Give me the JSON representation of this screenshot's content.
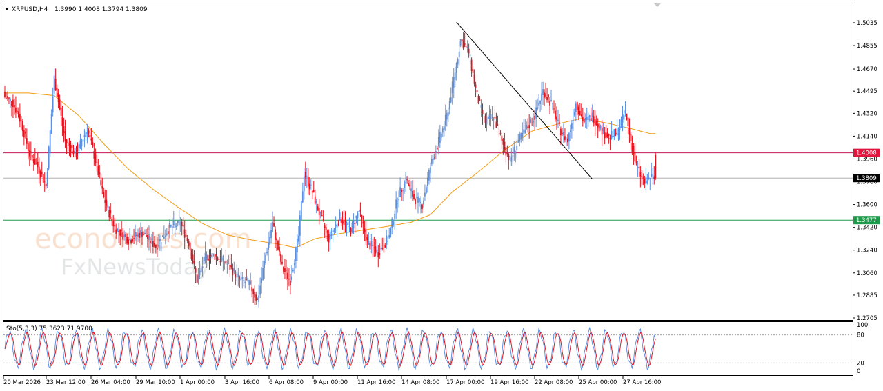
{
  "header": {
    "symbol_label": "XRPUSD,H4",
    "ohlc": "1.3990 1.4008 1.3794 1.3809"
  },
  "indicator": {
    "label": "Sto(5,3,3) 75.3623 71.9700",
    "levels": [
      "100",
      "80",
      "20",
      "0"
    ]
  },
  "watermark": {
    "line1": "economies.com",
    "line2": "FxNewsToday"
  },
  "price_axis": {
    "ticks": [
      "1.5035",
      "1.4855",
      "1.4670",
      "1.4495",
      "1.4320",
      "1.4140",
      "1.3960",
      "1.3780",
      "1.3600",
      "1.3420",
      "1.3240",
      "1.3060",
      "1.2885",
      "1.2705"
    ],
    "tick_values": [
      1.5035,
      1.4855,
      1.467,
      1.4495,
      1.432,
      1.414,
      1.396,
      1.378,
      1.36,
      1.342,
      1.324,
      1.306,
      1.2885,
      1.2705
    ],
    "badges": [
      {
        "label": "1.4008",
        "value": 1.4008,
        "color": "#e0143c",
        "text_color": "#ffffff"
      },
      {
        "label": "1.3809",
        "value": 1.3809,
        "color": "#000000",
        "text_color": "#ffffff"
      },
      {
        "label": "1.3477",
        "value": 1.3477,
        "color": "#1e9b4a",
        "text_color": "#ffffff"
      }
    ]
  },
  "time_axis": {
    "labels": [
      "20 Mar 2026",
      "23 Mar 12:00",
      "26 Mar 04:00",
      "29 Mar 10:00",
      "1 Apr 00:00",
      "3 Apr 16:00",
      "6 Apr 08:00",
      "9 Apr 00:00",
      "11 Apr 16:00",
      "14 Apr 08:00",
      "17 Apr 00:00",
      "19 Apr 16:00",
      "22 Apr 08:00",
      "25 Apr 00:00",
      "27 Apr 16:00"
    ]
  },
  "colors": {
    "bull": "#5b8fe0",
    "bear": "#e0141e",
    "ma": "#f39c12",
    "stoch_k": "#5b8fe0",
    "stoch_d": "#e0141e",
    "resistance": "#c2185b",
    "support": "#1e9b4a",
    "trendline": "#000000"
  },
  "chart_data": {
    "type": "candlestick",
    "symbol": "XRPUSD",
    "timeframe": "H4",
    "last_bar": {
      "open": 1.399,
      "high": 1.4008,
      "low": 1.3794,
      "close": 1.3809
    },
    "ylim": [
      1.2705,
      1.5035
    ],
    "horizontal_lines": [
      {
        "value": 1.4008
      },
      {
        "value": 1.3809
      },
      {
        "value": 1.3477
      }
    ],
    "trendline": [
      {
        "date": "17 Apr 00:00",
        "price": 1.504
      },
      {
        "date": "30 Apr 04:00",
        "price": 1.38
      }
    ],
    "close_waypoints": [
      [
        0,
        1.445
      ],
      [
        6,
        1.44
      ],
      [
        12,
        1.425
      ],
      [
        18,
        1.4
      ],
      [
        24,
        1.39
      ],
      [
        30,
        1.375
      ],
      [
        36,
        1.46
      ],
      [
        44,
        1.41
      ],
      [
        52,
        1.4
      ],
      [
        60,
        1.42
      ],
      [
        66,
        1.395
      ],
      [
        72,
        1.365
      ],
      [
        80,
        1.342
      ],
      [
        90,
        1.332
      ],
      [
        100,
        1.338
      ],
      [
        110,
        1.327
      ],
      [
        120,
        1.342
      ],
      [
        128,
        1.345
      ],
      [
        134,
        1.33
      ],
      [
        140,
        1.3
      ],
      [
        146,
        1.318
      ],
      [
        152,
        1.32
      ],
      [
        160,
        1.315
      ],
      [
        166,
        1.308
      ],
      [
        172,
        1.3
      ],
      [
        178,
        1.298
      ],
      [
        184,
        1.284
      ],
      [
        190,
        1.32
      ],
      [
        195,
        1.345
      ],
      [
        202,
        1.31
      ],
      [
        208,
        1.3
      ],
      [
        214,
        1.335
      ],
      [
        218,
        1.385
      ],
      [
        224,
        1.37
      ],
      [
        230,
        1.35
      ],
      [
        236,
        1.333
      ],
      [
        244,
        1.35
      ],
      [
        252,
        1.34
      ],
      [
        258,
        1.355
      ],
      [
        264,
        1.33
      ],
      [
        272,
        1.322
      ],
      [
        280,
        1.335
      ],
      [
        286,
        1.365
      ],
      [
        292,
        1.38
      ],
      [
        298,
        1.365
      ],
      [
        304,
        1.36
      ],
      [
        310,
        1.39
      ],
      [
        316,
        1.41
      ],
      [
        322,
        1.43
      ],
      [
        328,
        1.465
      ],
      [
        332,
        1.49
      ],
      [
        338,
        1.48
      ],
      [
        344,
        1.445
      ],
      [
        350,
        1.425
      ],
      [
        356,
        1.43
      ],
      [
        362,
        1.41
      ],
      [
        368,
        1.395
      ],
      [
        374,
        1.41
      ],
      [
        380,
        1.42
      ],
      [
        386,
        1.43
      ],
      [
        392,
        1.45
      ],
      [
        398,
        1.44
      ],
      [
        404,
        1.42
      ],
      [
        410,
        1.41
      ],
      [
        416,
        1.44
      ],
      [
        422,
        1.425
      ],
      [
        428,
        1.43
      ],
      [
        434,
        1.42
      ],
      [
        440,
        1.413
      ],
      [
        446,
        1.417
      ],
      [
        452,
        1.433
      ],
      [
        456,
        1.41
      ],
      [
        460,
        1.39
      ],
      [
        466,
        1.377
      ],
      [
        470,
        1.382
      ],
      [
        474,
        1.38
      ]
    ],
    "moving_average_waypoints": [
      [
        0,
        1.448
      ],
      [
        18,
        1.448
      ],
      [
        36,
        1.446
      ],
      [
        54,
        1.43
      ],
      [
        72,
        1.408
      ],
      [
        90,
        1.388
      ],
      [
        108,
        1.372
      ],
      [
        126,
        1.358
      ],
      [
        144,
        1.345
      ],
      [
        162,
        1.336
      ],
      [
        180,
        1.332
      ],
      [
        198,
        1.329
      ],
      [
        212,
        1.326
      ],
      [
        226,
        1.333
      ],
      [
        244,
        1.337
      ],
      [
        262,
        1.34
      ],
      [
        280,
        1.343
      ],
      [
        296,
        1.346
      ],
      [
        310,
        1.352
      ],
      [
        326,
        1.37
      ],
      [
        344,
        1.385
      ],
      [
        364,
        1.403
      ],
      [
        384,
        1.418
      ],
      [
        404,
        1.424
      ],
      [
        420,
        1.428
      ],
      [
        440,
        1.424
      ],
      [
        456,
        1.42
      ],
      [
        470,
        1.416
      ]
    ],
    "stochastic": {
      "k": 75.3623,
      "d": 71.97,
      "levels": [
        80,
        20
      ],
      "ylim": [
        0,
        100
      ]
    }
  }
}
